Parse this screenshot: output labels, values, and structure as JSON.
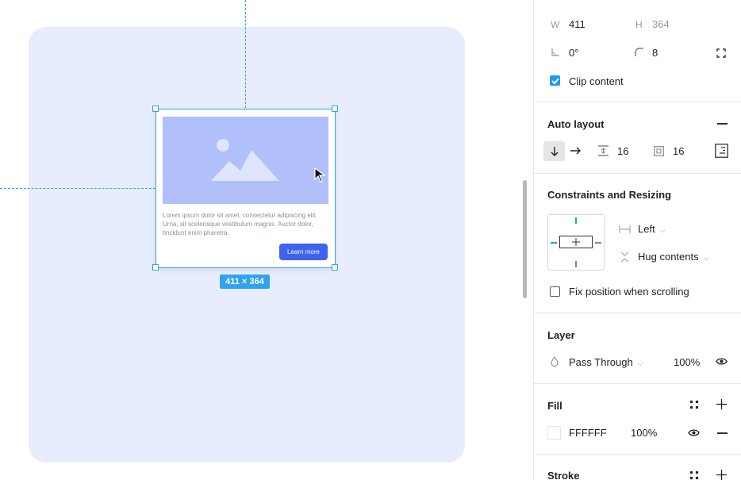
{
  "canvas": {
    "card": {
      "body_text": "Lorem ipsum dolor sit amet, consectetur adipiscing elit. Urna, sit scelerisque vestibulum magnis. Auctor dolor, tincidunt enim pharetra.",
      "button_label": "Learn more"
    },
    "size_badge": "411 × 364",
    "colors": {
      "frame_bg": "#e8edfd",
      "image_placeholder": "#b1c0fb",
      "accent_button": "#3f63f0",
      "selection": "#2fa3f0"
    }
  },
  "panel": {
    "frame": {
      "w_label": "W",
      "w_value": "411",
      "h_label": "H",
      "h_value": "364",
      "rotation_value": "0°",
      "radius_value": "8",
      "clip_content_label": "Clip content",
      "clip_content_checked": true
    },
    "auto_layout": {
      "title": "Auto layout",
      "spacing_value": "16",
      "padding_value": "16",
      "direction": "vertical"
    },
    "constraints": {
      "title": "Constraints and Resizing",
      "horizontal_value": "Left",
      "vertical_value": "Hug contents",
      "fix_position_label": "Fix position when scrolling",
      "fix_position_checked": false
    },
    "layer": {
      "title": "Layer",
      "blend_mode": "Pass Through",
      "opacity": "100%"
    },
    "fill": {
      "title": "Fill",
      "hex": "FFFFFF",
      "opacity": "100%"
    },
    "stroke": {
      "title": "Stroke"
    }
  }
}
